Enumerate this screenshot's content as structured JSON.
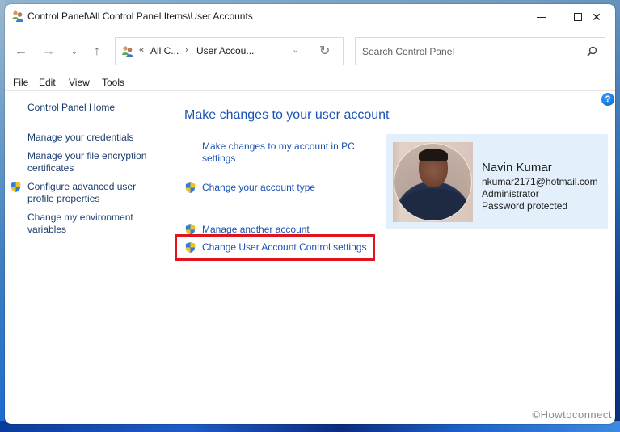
{
  "window": {
    "title": "Control Panel\\All Control Panel Items\\User Accounts",
    "controls": {
      "minimize": "minimize",
      "maximize": "maximize",
      "close": "✕"
    }
  },
  "navigation": {
    "back_icon": "←",
    "forward_icon": "→",
    "recent_icon": "⌄",
    "up_icon": "↑"
  },
  "address_bar": {
    "overflow_chevron": "«",
    "segments": [
      "All C...",
      "User Accou..."
    ],
    "separator": "›",
    "dropdown_icon": "⌄",
    "refresh_icon": "↻"
  },
  "search": {
    "placeholder": "Search Control Panel",
    "value": ""
  },
  "menu": {
    "items": [
      "File",
      "Edit",
      "View",
      "Tools"
    ]
  },
  "help": {
    "icon": "?"
  },
  "sidebar": {
    "items": [
      {
        "label": "Control Panel Home",
        "shield": false
      },
      {
        "label": "Manage your credentials",
        "shield": false
      },
      {
        "label": "Manage your file encryption certificates",
        "shield": false
      },
      {
        "label": "Configure advanced user profile properties",
        "shield": true
      },
      {
        "label": "Change my environment variables",
        "shield": false
      }
    ]
  },
  "main": {
    "title": "Make changes to your user account",
    "tasks": [
      {
        "label": "Make changes to my account in PC settings",
        "shield": false
      },
      {
        "label": "Change your account type",
        "shield": true
      },
      {
        "label": "Manage another account",
        "shield": true
      },
      {
        "label": "Change User Account Control settings",
        "shield": true,
        "highlighted": true
      }
    ]
  },
  "user": {
    "name": "Navin Kumar",
    "email": "nkumar2171@hotmail.com",
    "role": "Administrator",
    "password_status": "Password protected"
  },
  "annotation": {
    "highlight_color": "#e0141e"
  },
  "colors": {
    "link": "#1a52b3",
    "sidebar_link": "#1a3d6e",
    "card_background": "#e3f0fb"
  },
  "watermark": "©Howtoconnect"
}
